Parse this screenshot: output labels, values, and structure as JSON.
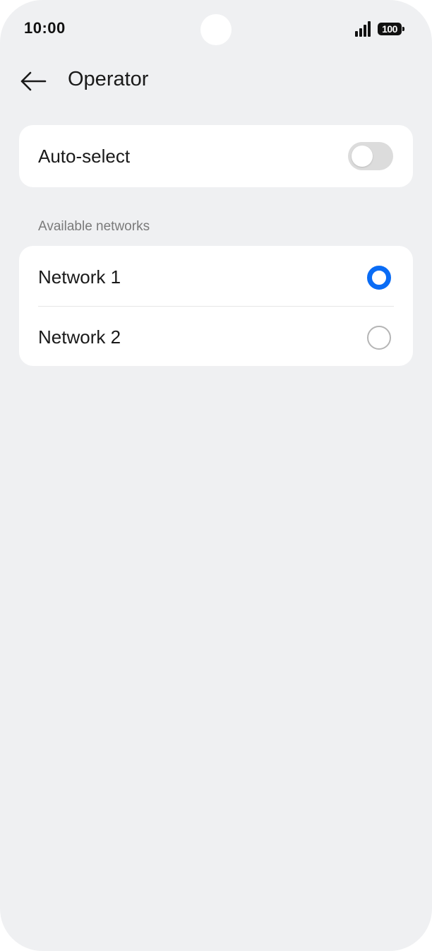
{
  "status_bar": {
    "time": "10:00",
    "battery_level": "100",
    "icons": [
      "signal-icon",
      "battery-icon"
    ]
  },
  "app_bar": {
    "back_icon": "back-arrow-icon",
    "title": "Operator"
  },
  "auto_select": {
    "label": "Auto-select",
    "enabled": false
  },
  "available_networks": {
    "header": "Available networks",
    "items": [
      {
        "label": "Network 1",
        "selected": true
      },
      {
        "label": "Network 2",
        "selected": false
      }
    ]
  },
  "colors": {
    "accent": "#0a6cf5",
    "background": "#eff0f2",
    "card": "#ffffff",
    "toggle_off": "#dcdcdc"
  }
}
